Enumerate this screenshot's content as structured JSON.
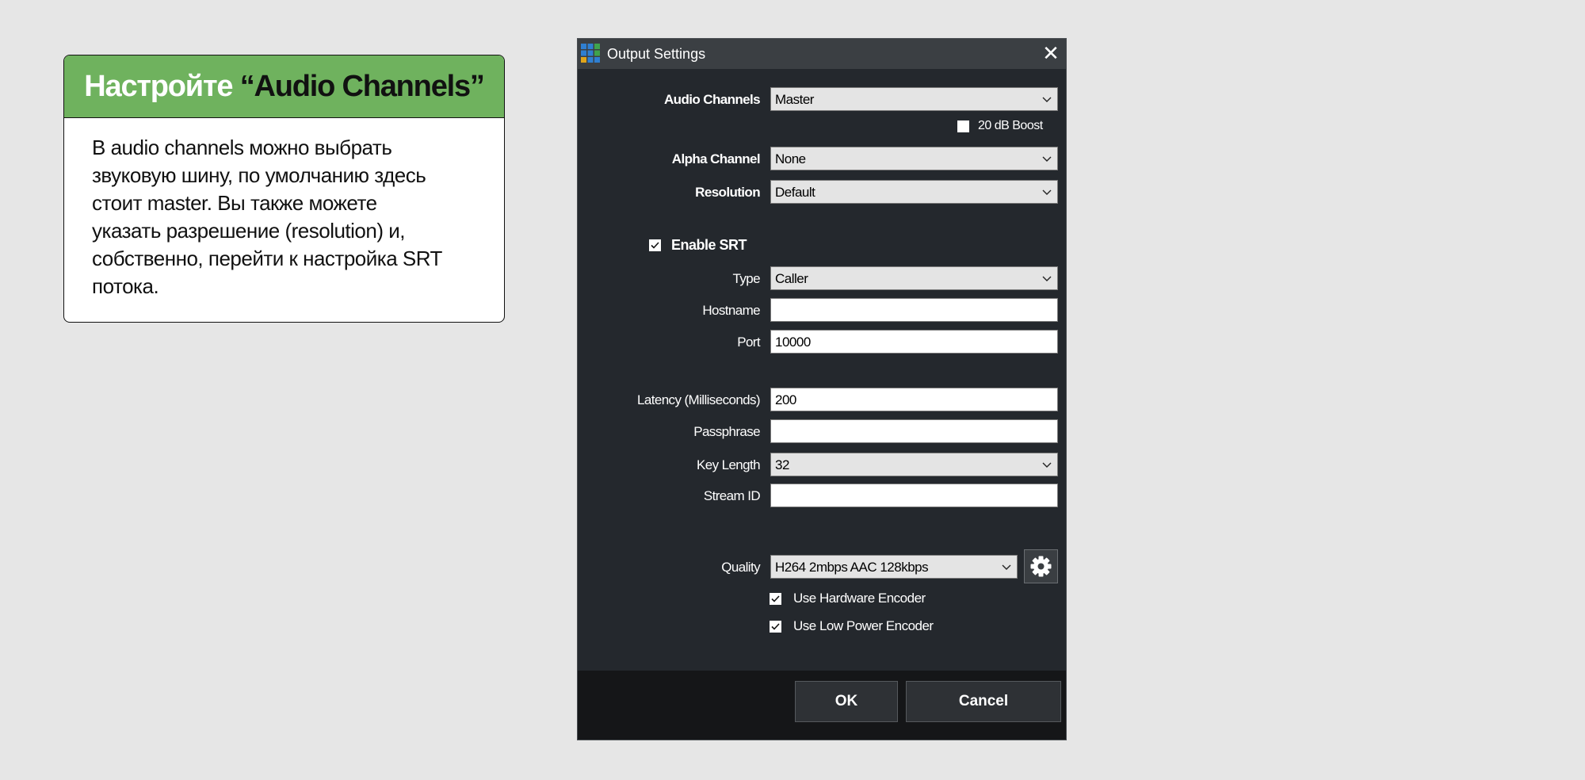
{
  "callout": {
    "title_prefix": "Настройте ",
    "title_accent": "“Audio Channels”",
    "body": "В audio channels можно выбрать\nзвуковую шину, по умолчанию здесь\nстоит master.  Вы также можете\nуказать разрешение (resolution) и,\nсобственно, перейти к настройка SRT\nпотока."
  },
  "dialog": {
    "title": "Output Settings",
    "close_glyph": "✕",
    "audio_channels": {
      "label": "Audio Channels",
      "value": "Master"
    },
    "boost": {
      "label": "20 dB Boost",
      "checked": false
    },
    "alpha_channel": {
      "label": "Alpha Channel",
      "value": "None"
    },
    "resolution": {
      "label": "Resolution",
      "value": "Default"
    },
    "enable_srt": {
      "label": "Enable SRT",
      "checked": true
    },
    "type": {
      "label": "Type",
      "value": "Caller"
    },
    "hostname": {
      "label": "Hostname",
      "value": ""
    },
    "port": {
      "label": "Port",
      "value": "10000"
    },
    "latency": {
      "label": "Latency (Milliseconds)",
      "value": "200"
    },
    "passphrase": {
      "label": "Passphrase",
      "value": ""
    },
    "key_length": {
      "label": "Key Length",
      "value": "32"
    },
    "stream_id": {
      "label": "Stream ID",
      "value": ""
    },
    "quality": {
      "label": "Quality",
      "value": "H264 2mbps AAC 128kbps"
    },
    "hardware_encoder": {
      "label": "Use Hardware Encoder",
      "checked": true
    },
    "low_power_encoder": {
      "label": "Use Low Power Encoder",
      "checked": true
    },
    "ok_label": "OK",
    "cancel_label": "Cancel"
  },
  "icons": {
    "app": "grid-app-icon",
    "close": "close-icon",
    "dropdown": "chevron-down-icon",
    "settings": "gear-icon",
    "check": "checkmark-icon"
  },
  "colors": {
    "page_background": "#e6e6e6",
    "callout_header": "#6fb25e",
    "dialog_background": "#24282d",
    "titlebar": "#3b3f43",
    "footer": "#151618"
  }
}
